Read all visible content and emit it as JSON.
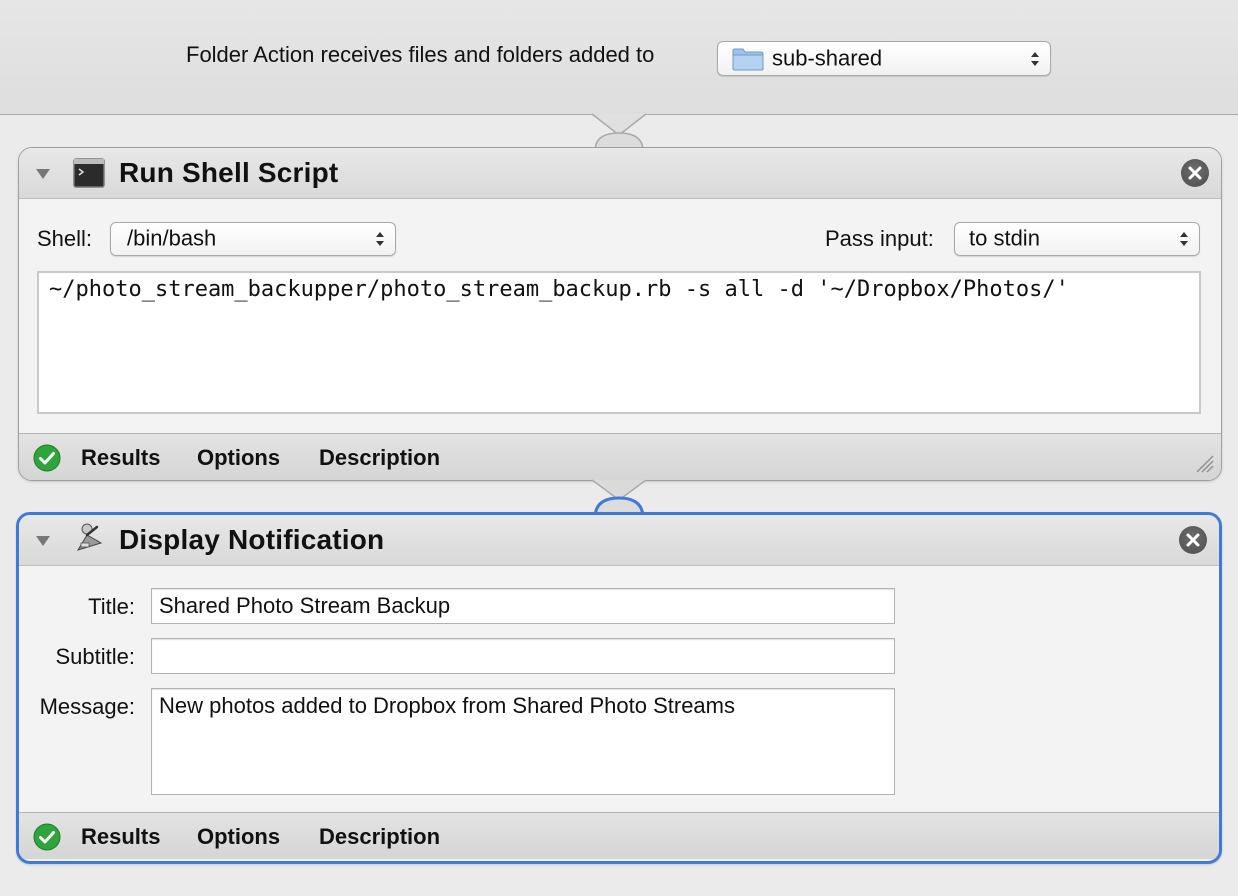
{
  "header": {
    "label": "Folder Action receives files and folders added to",
    "folder_popup": {
      "value": "sub-shared",
      "icon": "folder-icon"
    }
  },
  "run_shell_script": {
    "title": "Run Shell Script",
    "icon": "terminal-icon",
    "shell_label": "Shell:",
    "shell_value": "/bin/bash",
    "pass_input_label": "Pass input:",
    "pass_input_value": "to stdin",
    "script": "~/photo_stream_backupper/photo_stream_backup.rb -s all -d '~/Dropbox/Photos/'",
    "footer_tabs": [
      "Results",
      "Options",
      "Description"
    ]
  },
  "display_notification": {
    "title": "Display Notification",
    "icon": "notification-icon",
    "title_label": "Title:",
    "title_value": "Shared Photo Stream Backup",
    "subtitle_label": "Subtitle:",
    "subtitle_value": "",
    "message_label": "Message:",
    "message_value": "New photos added to Dropbox from Shared Photo Streams",
    "footer_tabs": [
      "Results",
      "Options",
      "Description"
    ]
  },
  "colors": {
    "selection_accent": "#3f7ad8",
    "success_green": "#2fa43a"
  }
}
